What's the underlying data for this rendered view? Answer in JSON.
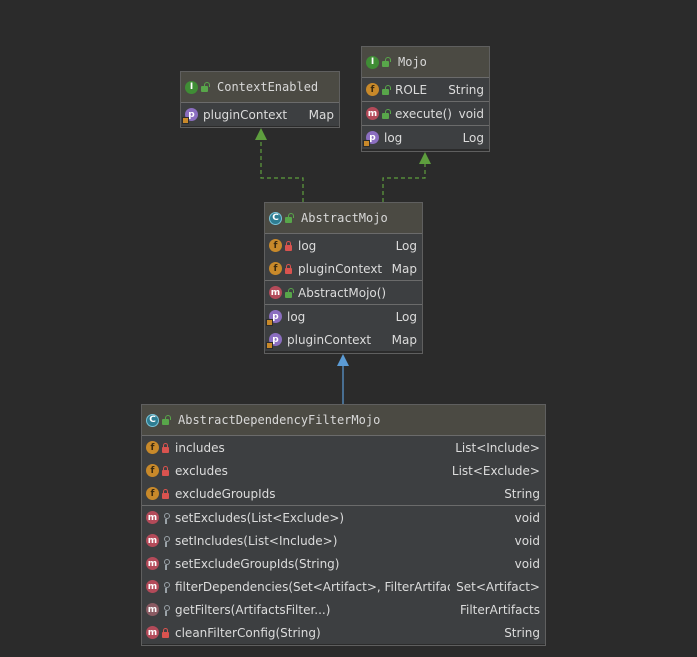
{
  "classes": {
    "context_enabled": {
      "name": "ContextEnabled",
      "kind": "I",
      "fields": [],
      "methods": [],
      "properties": [
        {
          "name": "pluginContext",
          "type": "Map",
          "badge": "p"
        }
      ]
    },
    "mojo": {
      "name": "Mojo",
      "kind": "I",
      "fields": [
        {
          "name": "ROLE",
          "type": "String",
          "badge": "f"
        }
      ],
      "methods": [
        {
          "name": "execute()",
          "type": "void",
          "badge": "m"
        }
      ],
      "properties": [
        {
          "name": "log",
          "type": "Log",
          "badge": "p"
        }
      ]
    },
    "abstract_mojo": {
      "name": "AbstractMojo",
      "kind": "C",
      "fields": [
        {
          "name": "log",
          "type": "Log",
          "badge": "f"
        },
        {
          "name": "pluginContext",
          "type": "Map",
          "badge": "f"
        }
      ],
      "methods": [
        {
          "name": "AbstractMojo()",
          "type": "",
          "badge": "m"
        }
      ],
      "properties": [
        {
          "name": "log",
          "type": "Log",
          "badge": "p"
        },
        {
          "name": "pluginContext",
          "type": "Map",
          "badge": "p"
        }
      ]
    },
    "filter_mojo": {
      "name": "AbstractDependencyFilterMojo",
      "kind": "C",
      "fields": [
        {
          "name": "includes",
          "type": "List<Include>",
          "badge": "f"
        },
        {
          "name": "excludes",
          "type": "List<Exclude>",
          "badge": "f"
        },
        {
          "name": "excludeGroupIds",
          "type": "String",
          "badge": "f"
        }
      ],
      "methods": [
        {
          "name": "setExcludes(List<Exclude>)",
          "type": "void",
          "badge": "m"
        },
        {
          "name": "setIncludes(List<Include>)",
          "type": "void",
          "badge": "m"
        },
        {
          "name": "setExcludeGroupIds(String)",
          "type": "void",
          "badge": "m"
        },
        {
          "name": "filterDependencies(Set<Artifact>, FilterArtifacts)",
          "type": "Set<Artifact>",
          "badge": "m"
        },
        {
          "name": "getFilters(ArtifactsFilter...)",
          "type": "FilterArtifacts",
          "badge": "m"
        },
        {
          "name": "cleanFilterConfig(String)",
          "type": "String",
          "badge": "m"
        }
      ],
      "properties": []
    }
  },
  "colors": {
    "background": "#2b2b2b",
    "header": "#4b4a43",
    "body": "#3d3f41",
    "implements_arrow": "#5e9e3e",
    "extends_arrow": "#5b9bd5"
  }
}
